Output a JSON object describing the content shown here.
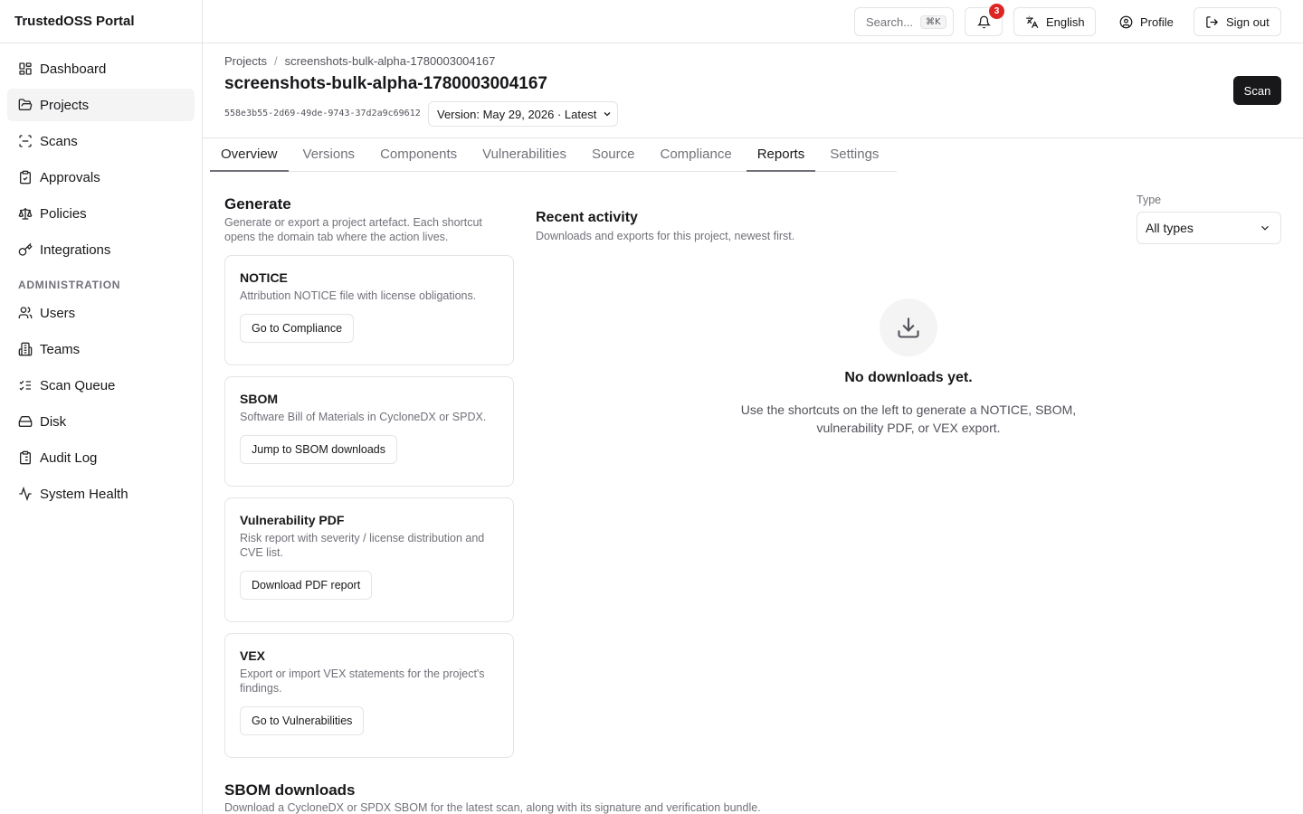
{
  "app": {
    "title": "TrustedOSS Portal"
  },
  "sidebar": {
    "items": [
      {
        "label": "Dashboard",
        "icon": "dashboard-icon"
      },
      {
        "label": "Projects",
        "icon": "folder-icon",
        "active": true
      },
      {
        "label": "Scans",
        "icon": "scan-icon"
      },
      {
        "label": "Approvals",
        "icon": "clipboard-check-icon"
      },
      {
        "label": "Policies",
        "icon": "scale-icon"
      },
      {
        "label": "Integrations",
        "icon": "key-icon"
      }
    ],
    "admin_section_label": "ADMINISTRATION",
    "admin_items": [
      {
        "label": "Users",
        "icon": "users-icon"
      },
      {
        "label": "Teams",
        "icon": "building-icon"
      },
      {
        "label": "Scan Queue",
        "icon": "list-checks-icon"
      },
      {
        "label": "Disk",
        "icon": "hard-drive-icon"
      },
      {
        "label": "Audit Log",
        "icon": "clipboard-list-icon"
      },
      {
        "label": "System Health",
        "icon": "activity-icon"
      }
    ]
  },
  "topbar": {
    "search_placeholder": "Search...",
    "search_shortcut": "⌘K",
    "notification_count": "3",
    "language": "English",
    "profile": "Profile",
    "sign_out": "Sign out"
  },
  "header": {
    "breadcrumb_root": "Projects",
    "breadcrumb_sep": "/",
    "breadcrumb_current": "screenshots-bulk-alpha-1780003004167",
    "title": "screenshots-bulk-alpha-1780003004167",
    "uuid": "558e3b55-2d69-49de-9743-37d2a9c69612",
    "version": "Version: May 29, 2026 · Latest",
    "scan_button": "Scan"
  },
  "tabs": [
    {
      "label": "Overview"
    },
    {
      "label": "Versions"
    },
    {
      "label": "Components"
    },
    {
      "label": "Vulnerabilities"
    },
    {
      "label": "Source"
    },
    {
      "label": "Compliance"
    },
    {
      "label": "Reports",
      "active": true
    },
    {
      "label": "Settings"
    }
  ],
  "generate": {
    "title": "Generate",
    "description": "Generate or export a project artefact. Each shortcut opens the domain tab where the action lives.",
    "cards": [
      {
        "title": "NOTICE",
        "description": "Attribution NOTICE file with license obligations.",
        "button": "Go to Compliance"
      },
      {
        "title": "SBOM",
        "description": "Software Bill of Materials in CycloneDX or SPDX.",
        "button": "Jump to SBOM downloads"
      },
      {
        "title": "Vulnerability PDF",
        "description": "Risk report with severity / license distribution and CVE list.",
        "button": "Download PDF report"
      },
      {
        "title": "VEX",
        "description": "Export or import VEX statements for the project's findings.",
        "button": "Go to Vulnerabilities"
      }
    ]
  },
  "recent_activity": {
    "title": "Recent activity",
    "description": "Downloads and exports for this project, newest first.",
    "type_label": "Type",
    "type_value": "All types",
    "empty_title": "No downloads yet.",
    "empty_description": "Use the shortcuts on the left to generate a NOTICE, SBOM, vulnerability PDF, or VEX export."
  },
  "sbom_downloads": {
    "title": "SBOM downloads",
    "description": "Download a CycloneDX or SPDX SBOM for the latest scan, along with its signature and verification bundle."
  },
  "colors": {
    "primary": "#18181b",
    "border": "#e4e4e7",
    "muted_text": "#71717a",
    "active_nav_bg": "#f4f4f5",
    "badge": "#dc2626"
  }
}
